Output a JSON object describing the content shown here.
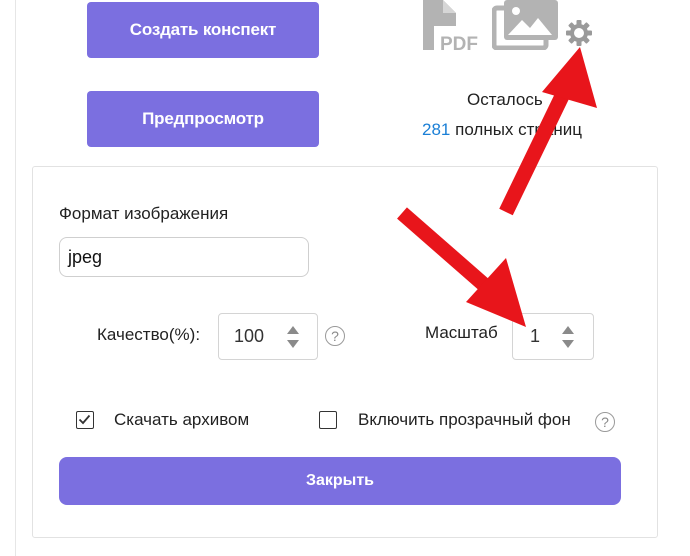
{
  "buttons": {
    "create_summary": "Создать конспект",
    "preview": "Предпросмотр"
  },
  "icons": {
    "pdf_label": "PDF"
  },
  "remaining": {
    "label": "Осталось",
    "count": "281",
    "suffix": "полных страниц"
  },
  "settings": {
    "format_label": "Формат изображения",
    "format_value": "jpeg",
    "quality_label": "Качество(%):",
    "quality_value": "100",
    "scale_label": "Масштаб",
    "scale_value": "1",
    "help_symbol": "?",
    "download_archive_label": "Скачать архивом",
    "download_archive_checked": true,
    "transparent_bg_label": "Включить прозрачный фон",
    "transparent_bg_checked": false,
    "close_label": "Закрыть"
  },
  "colors": {
    "accent": "#7b6fe0",
    "link": "#1a7fd6",
    "annotation_arrow": "#e8151b",
    "icon_gray": "#b3b3b3"
  }
}
